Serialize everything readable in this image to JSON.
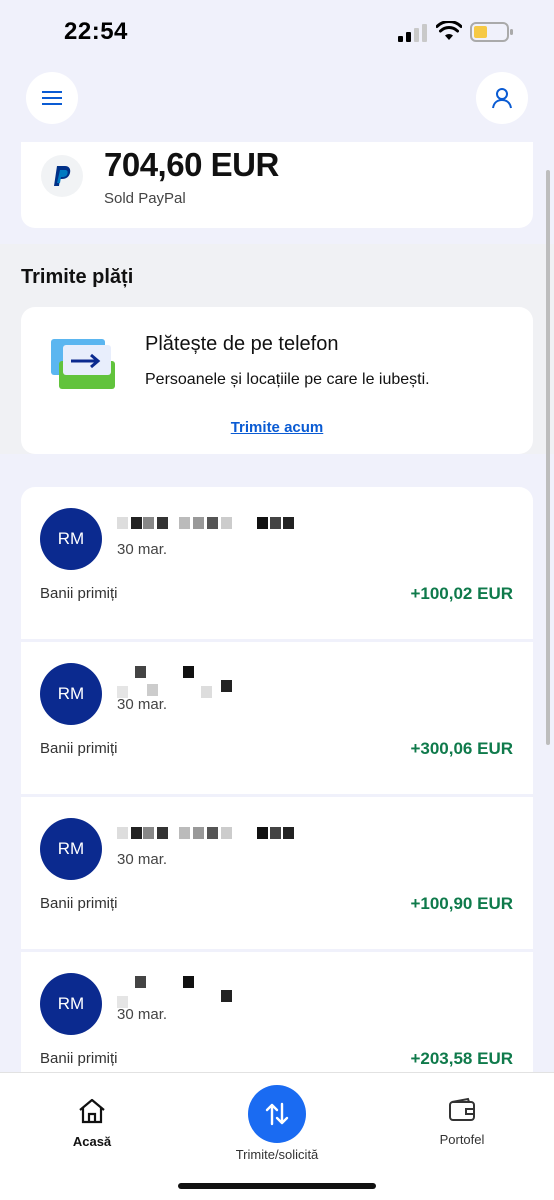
{
  "status_bar": {
    "time": "22:54",
    "signal_icon": "cellular-signal-icon",
    "wifi_icon": "wifi-icon",
    "battery_icon": "battery-icon",
    "battery_color": "#f6c945"
  },
  "header": {
    "menu_icon": "hamburger-menu-icon",
    "profile_icon": "person-icon"
  },
  "balance": {
    "amount": "704,60 EUR",
    "label": "Sold PayPal",
    "logo_icon": "paypal-logo-icon"
  },
  "send_payments": {
    "title": "Trimite plăți",
    "card": {
      "heading": "Plătește de pe telefon",
      "subtitle": "Persoanele și locațiile pe care le iubești.",
      "link": "Trimite acum",
      "illustration_icon": "send-money-cards-icon"
    }
  },
  "transactions": [
    {
      "initials": "RM",
      "date": "30 mar.",
      "type": "Banii primiți",
      "amount": "+100,02 EUR"
    },
    {
      "initials": "RM",
      "date": "30 mar.",
      "type": "Banii primiți",
      "amount": "+300,06 EUR"
    },
    {
      "initials": "RM",
      "date": "30 mar.",
      "type": "Banii primiți",
      "amount": "+100,90 EUR"
    },
    {
      "initials": "RM",
      "date": "30 mar.",
      "type": "Banii primiți",
      "amount": "+203,58 EUR"
    }
  ],
  "bottom_nav": {
    "home_label": "Acasă",
    "home_icon": "home-icon",
    "send_label": "Trimite/solicită",
    "send_icon": "swap-arrows-icon",
    "wallet_label": "Portofel",
    "wallet_icon": "wallet-icon"
  },
  "colors": {
    "accent": "#1a6bf2",
    "avatar": "#0b2a8f",
    "amount_positive": "#0f7a4b",
    "link": "#0a5bd3",
    "background": "#f0f1fb"
  }
}
